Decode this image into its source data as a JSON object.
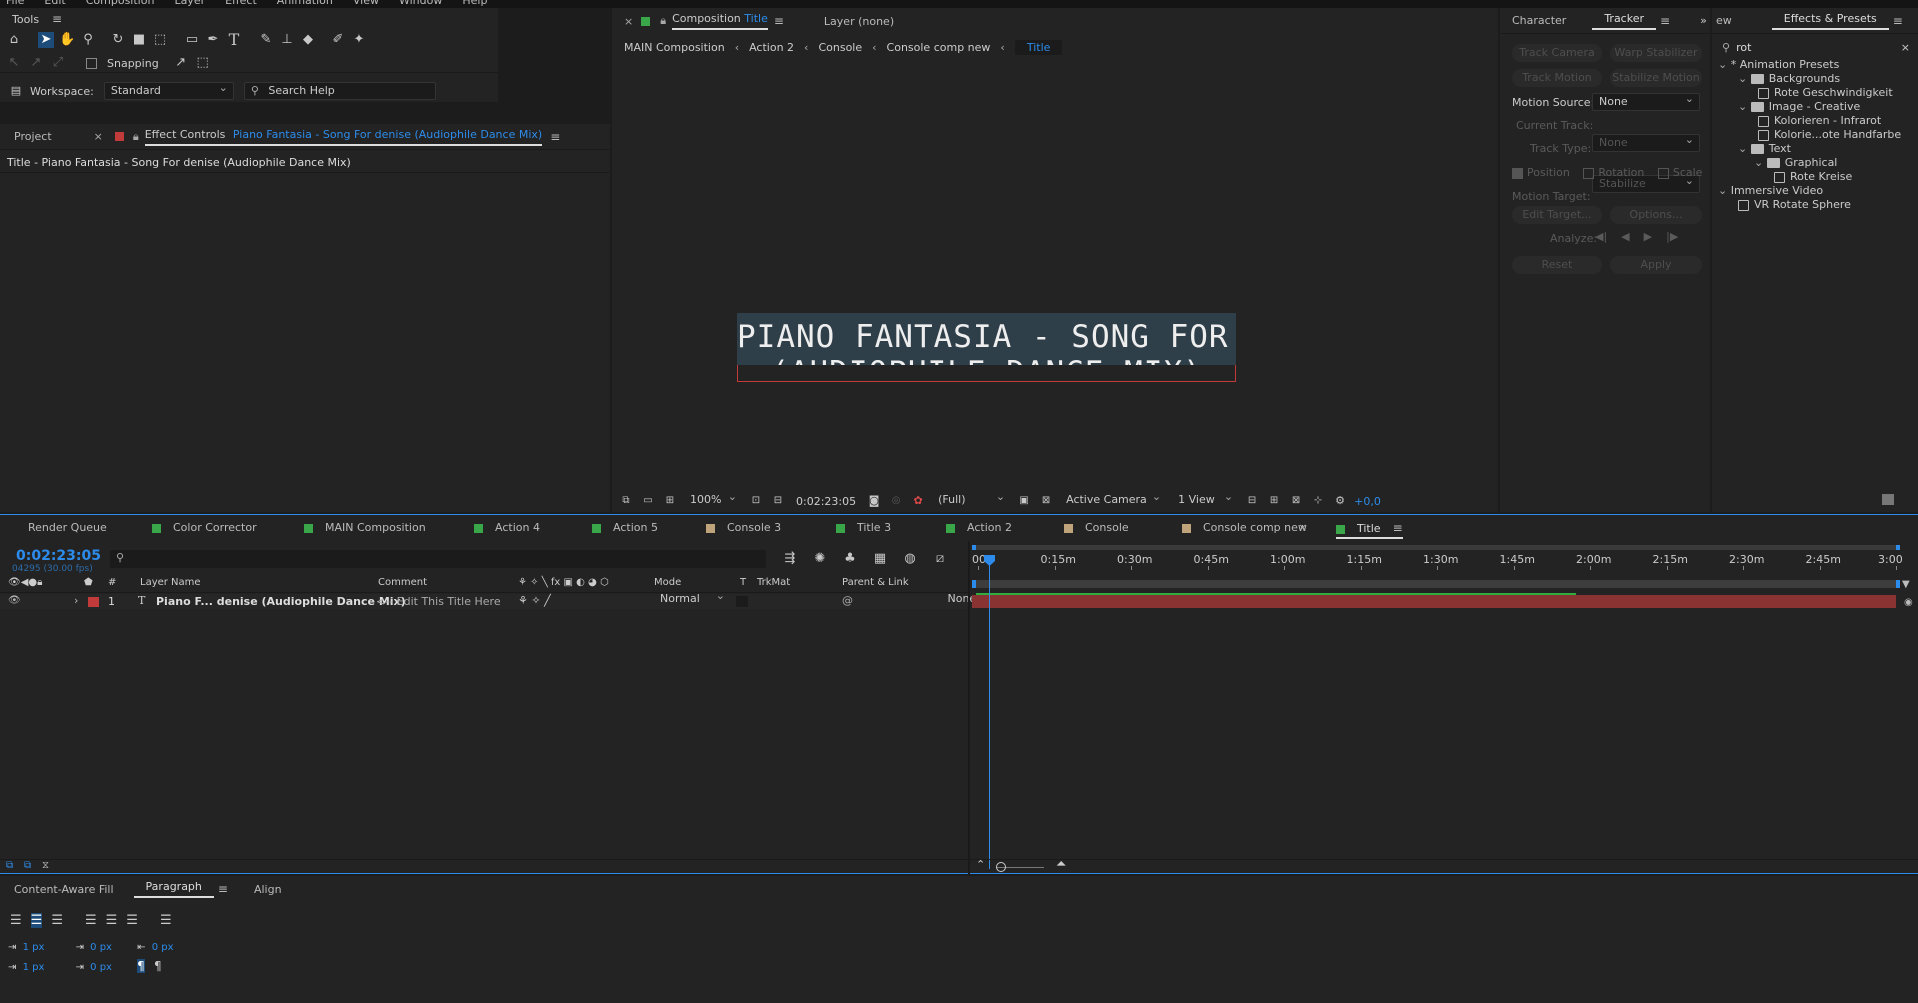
{
  "menu": [
    "File",
    "Edit",
    "Composition",
    "Layer",
    "Effect",
    "Animation",
    "View",
    "Window",
    "Help"
  ],
  "tools": {
    "title": "Tools",
    "snapping": "Snapping",
    "workspace_label": "Workspace:",
    "workspace_value": "Standard",
    "search_help": "Search Help"
  },
  "project": {
    "tab_project": "Project",
    "effect_controls_label": "Effect Controls",
    "effect_controls_target": "Piano Fantasia - Song For denise (Audiophile Dance Mix)",
    "layer_path": "Title - Piano Fantasia - Song For denise (Audiophile Dance Mix)"
  },
  "composition": {
    "tab_label": "Composition",
    "tab_name": "Title",
    "layer_label": "Layer (none)",
    "breadcrumbs": [
      "MAIN Composition",
      "Action 2",
      "Console",
      "Console comp new",
      "Title"
    ],
    "preview_line1": "PIANO FANTASIA - SONG FOR DENISE",
    "preview_line2": "(AUDIOPHILE DANCE MIX)",
    "zoom": "100%",
    "timecode": "0:02:23:05",
    "resolution": "(Full)",
    "camera": "Active Camera",
    "view": "1 View",
    "exposure": "+0,0"
  },
  "tracker": {
    "tab_character": "Character",
    "tab_tracker": "Tracker",
    "track_camera": "Track Camera",
    "warp_stabilizer": "Warp Stabilizer",
    "track_motion": "Track Motion",
    "stabilize_motion": "Stabilize Motion",
    "motion_source_label": "Motion Source:",
    "motion_source_value": "None",
    "current_track_label": "Current Track:",
    "current_track_value": "None",
    "track_type_label": "Track Type:",
    "track_type_value": "Stabilize",
    "position": "Position",
    "rotation": "Rotation",
    "scale": "Scale",
    "motion_target": "Motion Target:",
    "edit_target": "Edit Target...",
    "options": "Options...",
    "analyze": "Analyze:",
    "reset": "Reset",
    "apply": "Apply"
  },
  "effects": {
    "tab_prev": "ew",
    "tab_label": "Effects & Presets",
    "search_value": "rot",
    "tree": [
      {
        "label": "* Animation Presets",
        "type": "root"
      },
      {
        "label": "Backgrounds",
        "type": "folder"
      },
      {
        "label": "Rote Geschwindigkeit",
        "type": "preset"
      },
      {
        "label": "Image - Creative",
        "type": "folder"
      },
      {
        "label": "Kolorieren - Infrarot",
        "type": "preset"
      },
      {
        "label": "Kolorie...ote Handfarbe",
        "type": "preset"
      },
      {
        "label": "Text",
        "type": "folder"
      },
      {
        "label": "Graphical",
        "type": "folder"
      },
      {
        "label": "Rote Kreise",
        "type": "preset"
      },
      {
        "label": "Immersive Video",
        "type": "root"
      },
      {
        "label": "VR Rotate Sphere",
        "type": "preset"
      }
    ]
  },
  "timeline": {
    "tabs": [
      {
        "label": "Render Queue",
        "color": ""
      },
      {
        "label": "Color Corrector",
        "color": "#3aa64a"
      },
      {
        "label": "MAIN Composition",
        "color": "#3aa64a"
      },
      {
        "label": "Action 4",
        "color": "#3aa64a"
      },
      {
        "label": "Action 5",
        "color": "#3aa64a"
      },
      {
        "label": "Console 3",
        "color": "#bfa37a"
      },
      {
        "label": "Title 3",
        "color": "#3aa64a"
      },
      {
        "label": "Action 2",
        "color": "#3aa64a"
      },
      {
        "label": "Console",
        "color": "#bfa37a"
      },
      {
        "label": "Console comp new",
        "color": "#bfa37a"
      },
      {
        "label": "Title",
        "color": "#3aa64a"
      }
    ],
    "timecode": "0:02:23:05",
    "frames": "04295 (30.00 fps)",
    "columns": {
      "layer_name": "Layer Name",
      "comment": "Comment",
      "mode": "Mode",
      "t": "T",
      "trkmat": "TrkMat",
      "parent": "Parent & Link",
      "num": "#"
    },
    "layer": {
      "index": "1",
      "type": "T",
      "name": "Piano F... denise (Audiophile Dance Mix)",
      "comment": "<-- Edit This Title Here",
      "mode": "Normal",
      "parent": "None",
      "color": "#c23b3b"
    },
    "ruler": [
      "00s",
      "0:15m",
      "0:30m",
      "0:45m",
      "1:00m",
      "1:15m",
      "1:30m",
      "1:45m",
      "2:00m",
      "2:15m",
      "2:30m",
      "2:45m",
      "3:00"
    ],
    "playhead_seconds": 143.17,
    "duration_seconds": 180
  },
  "paragraph": {
    "tab_caf": "Content-Aware Fill",
    "tab_paragraph": "Paragraph",
    "tab_align": "Align",
    "indent_left": "1 px",
    "indent_first": "1 px",
    "space_before": "0 px",
    "space_after": "0 px",
    "indent_right": "0 px"
  }
}
